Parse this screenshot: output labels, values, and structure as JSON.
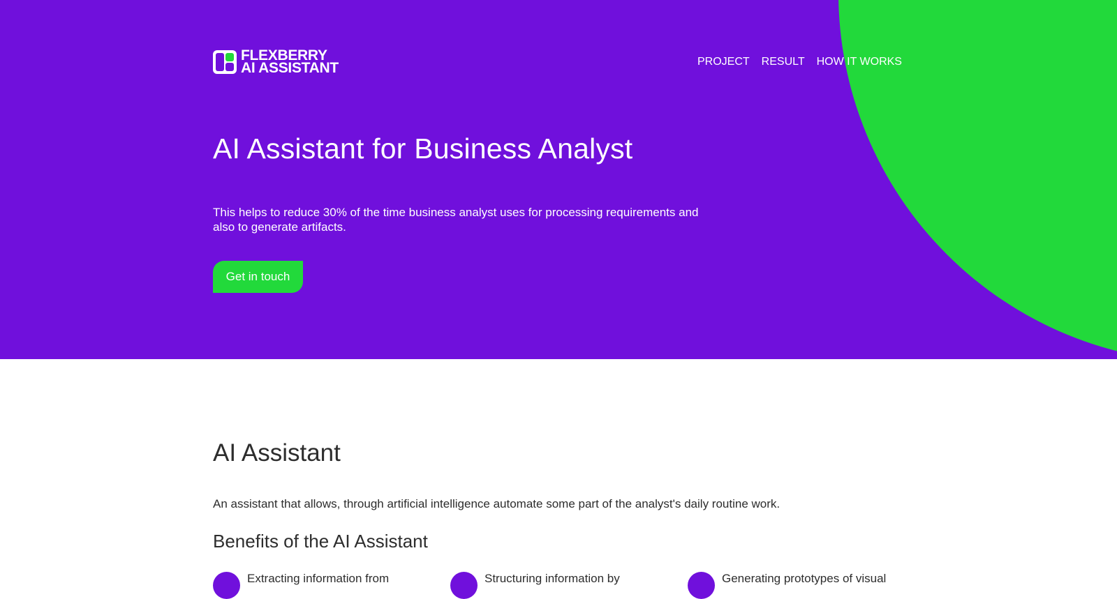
{
  "brand": {
    "line1": "FLEXBERRY",
    "line2": "AI ASSISTANT",
    "colors": {
      "primary": "#7010dc",
      "accent": "#22d93b"
    }
  },
  "nav": {
    "items": [
      {
        "label": "PROJECT"
      },
      {
        "label": "RESULT"
      },
      {
        "label": "HOW IT WORKS"
      }
    ]
  },
  "hero": {
    "title": "AI Assistant for Business Analyst",
    "description": "This helps to reduce 30% of the time business analyst uses for processing requirements and also to generate artifacts.",
    "cta_label": "Get in touch"
  },
  "about": {
    "title": "AI Assistant",
    "description": "An assistant that allows, through artificial intelligence automate some part of the analyst's daily routine work."
  },
  "benefits": {
    "title": "Benefits of the AI Assistant",
    "items": [
      {
        "label": "Extracting information from",
        "icon": "check-icon"
      },
      {
        "label": "Structuring information by",
        "icon": "check-icon"
      },
      {
        "label": "Generating prototypes of visual",
        "icon": "check-icon"
      }
    ]
  }
}
